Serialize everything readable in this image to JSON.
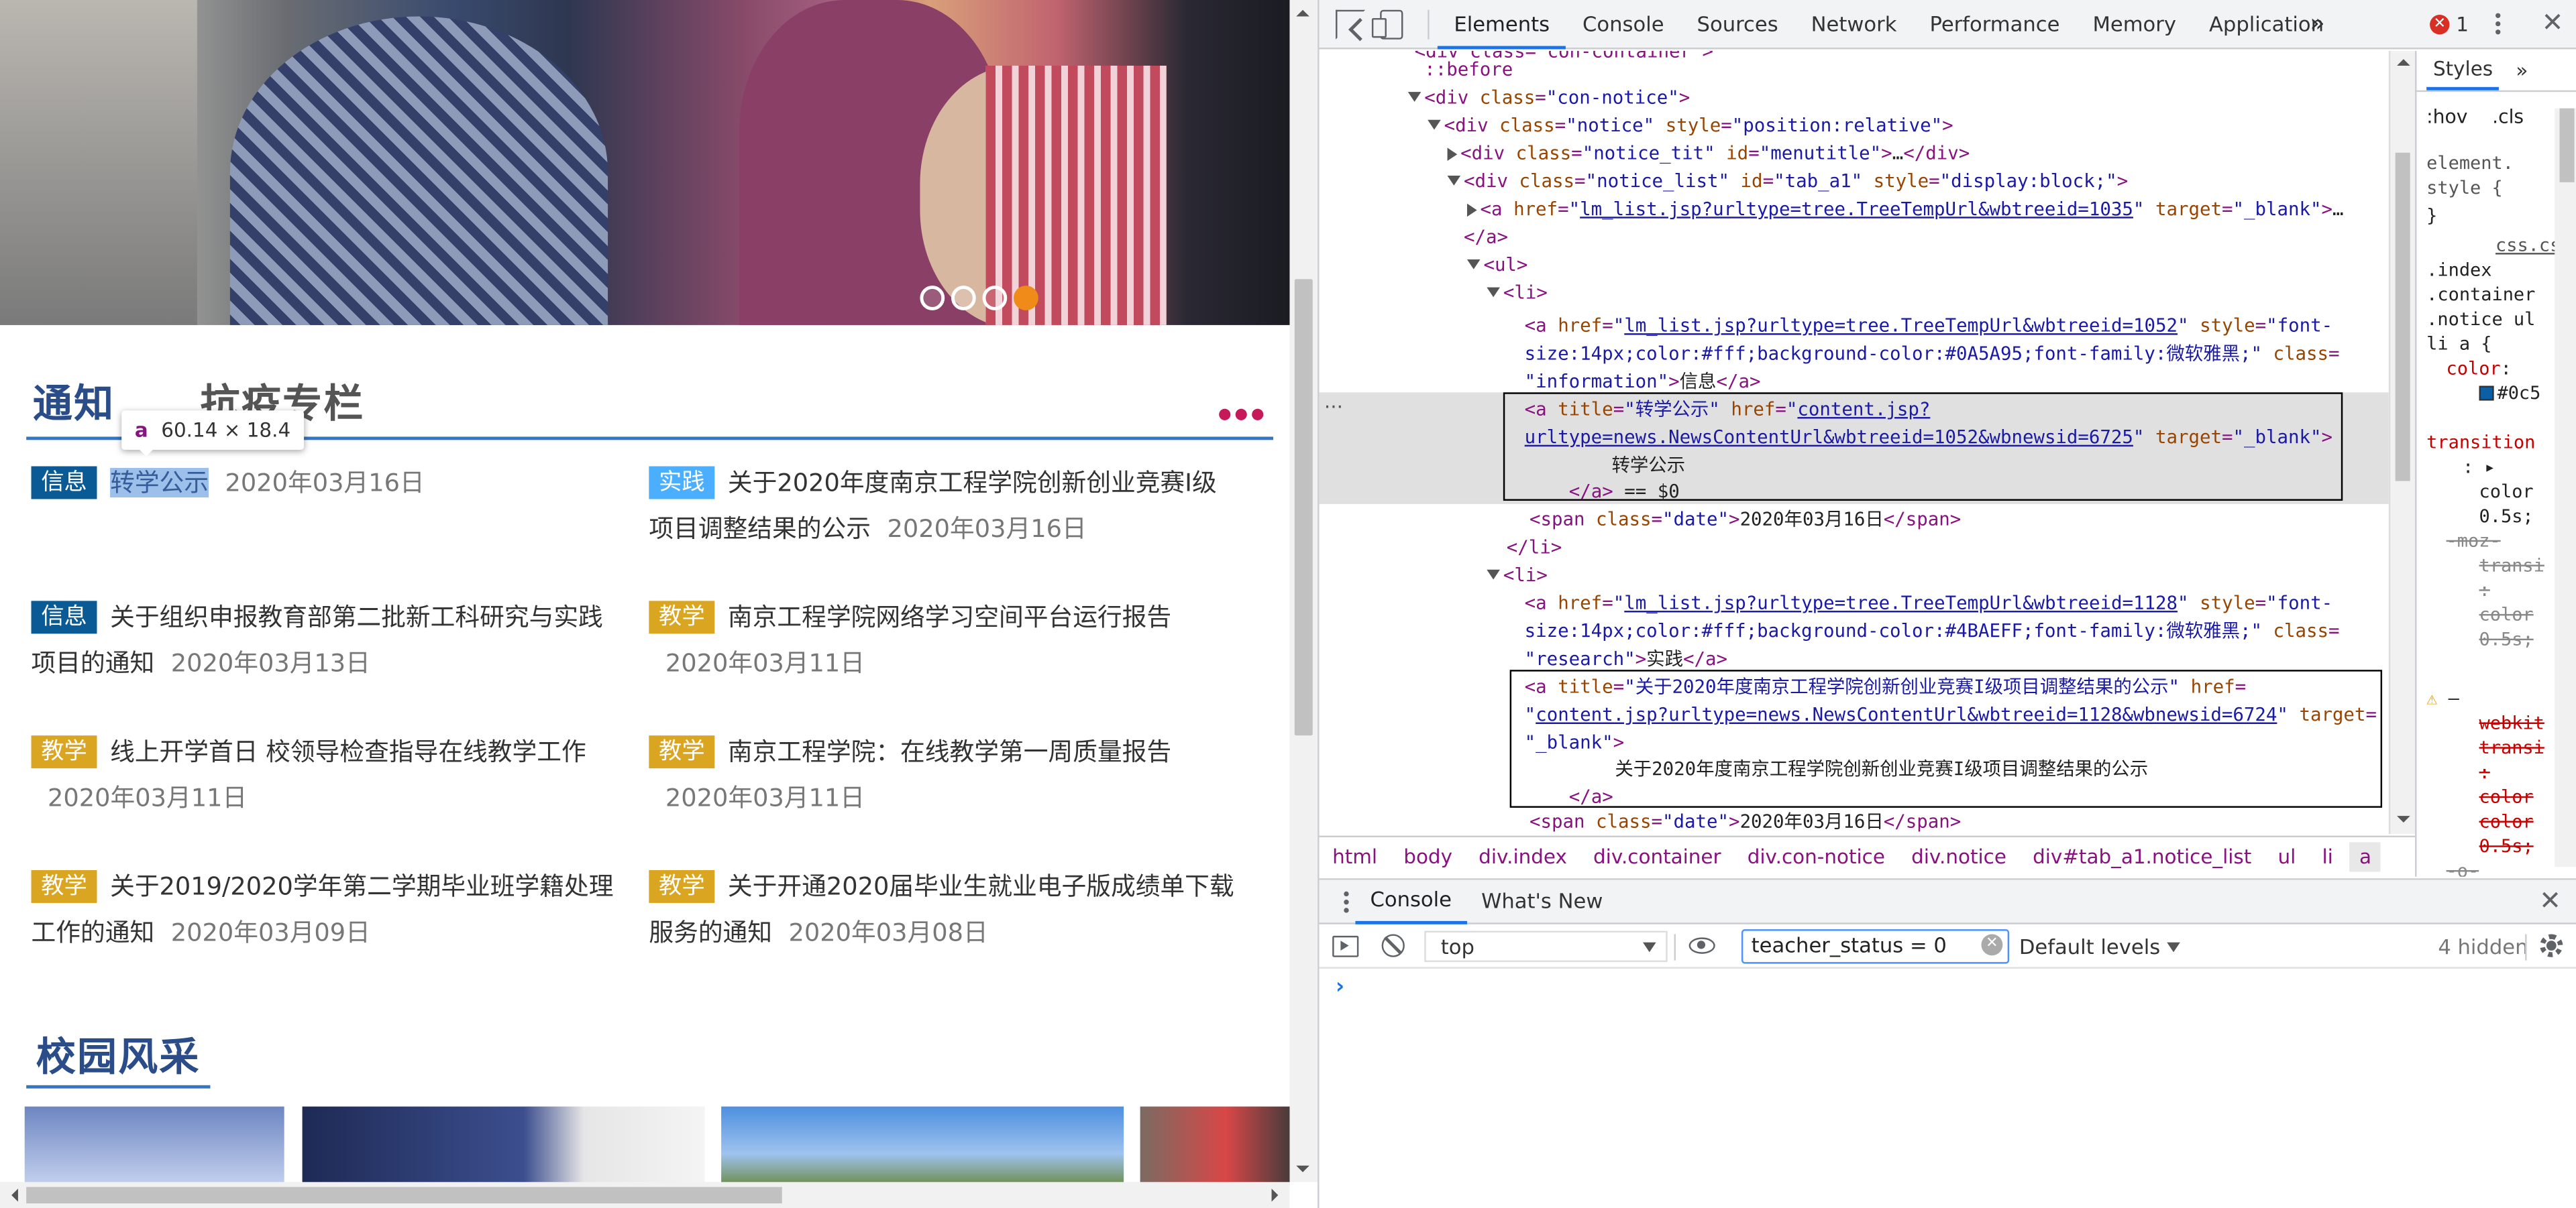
{
  "site": {
    "tabs": [
      "通知",
      "抗疫专栏"
    ],
    "tooltip": {
      "tag": "a",
      "size": "60.14 × 18.4"
    },
    "news_left": [
      {
        "tag": "信息",
        "tag_color": "#0A5A95",
        "title": "转学公示",
        "date": "2020年03月16日"
      },
      {
        "tag": "信息",
        "tag_color": "#0A5A95",
        "title": "关于组织申报教育部第二批新工科研究与实践项目的通知",
        "date": "2020年03月13日"
      },
      {
        "tag": "教学",
        "tag_color": "#DAA520",
        "title": "线上开学首日 校领导检查指导在线教学工作",
        "date": "2020年03月11日"
      },
      {
        "tag": "教学",
        "tag_color": "#DAA520",
        "title": "关于2019/2020学年第二学期毕业班学籍处理工作的通知",
        "date": "2020年03月09日"
      }
    ],
    "news_right": [
      {
        "tag": "实践",
        "tag_color": "#4BAEFF",
        "title": "关于2020年度南京工程学院创新创业竞赛I级项目调整结果的公示",
        "date": "2020年03月16日"
      },
      {
        "tag": "教学",
        "tag_color": "#DAA520",
        "title": "南京工程学院网络学习空间平台运行报告",
        "date": "2020年03月11日"
      },
      {
        "tag": "教学",
        "tag_color": "#DAA520",
        "title": "南京工程学院：在线教学第一周质量报告",
        "date": "2020年03月11日"
      },
      {
        "tag": "教学",
        "tag_color": "#DAA520",
        "title": "关于开通2020届毕业生就业电子版成绩单下载服务的通知",
        "date": "2020年03月08日"
      }
    ],
    "section2_title": "校园风采"
  },
  "devtools": {
    "panel_tabs": [
      "Elements",
      "Console",
      "Sources",
      "Network",
      "Performance",
      "Memory",
      "Application"
    ],
    "more_tabs": "»",
    "error_count": "1",
    "breadcrumb": [
      "html",
      "body",
      "div.index",
      "div.container",
      "div.con-notice",
      "div.notice",
      "div#tab_a1.notice_list",
      "ul",
      "li",
      "a"
    ],
    "styles_tabs": [
      "Styles",
      "»"
    ],
    "styles_filter": [
      ":hov",
      ".cls"
    ],
    "drawer_tabs": [
      "Console",
      "What's New"
    ],
    "console": {
      "context": "top",
      "filter_value": "teacher_status = 0",
      "levels": "Default levels",
      "hidden": "4 hidden",
      "prompt": "›"
    },
    "accent_color": "#1a73e8"
  }
}
